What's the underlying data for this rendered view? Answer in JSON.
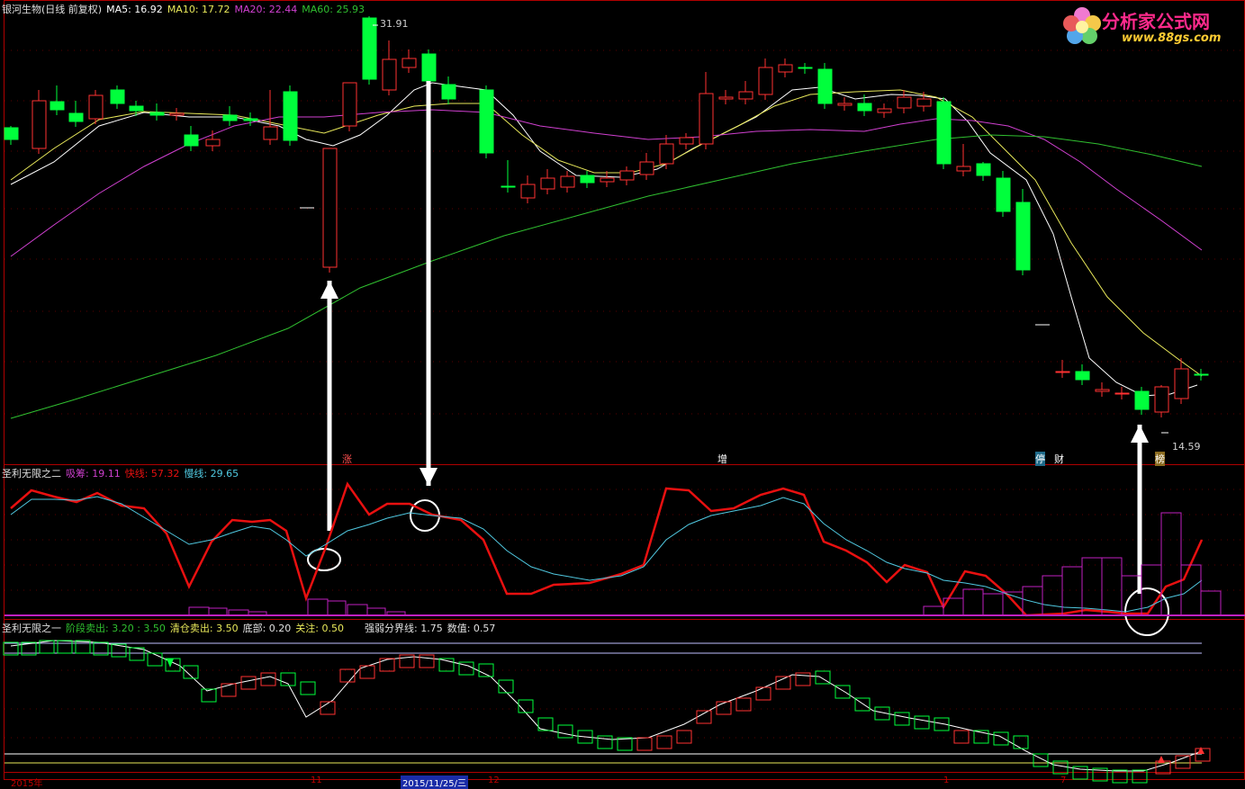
{
  "header": {
    "stock": "银河生物(日线 前复权)",
    "ma5": "MA5: 16.92",
    "ma10": "MA10: 17.72",
    "ma20": "MA20: 22.44",
    "ma60": "MA60: 25.93"
  },
  "logo": {
    "name": "分析家公式网",
    "url": "www.88gs.com"
  },
  "price_high_label": "31.91",
  "price_low_label": "14.59",
  "markers": {
    "zhang": "涨",
    "zeng": "增",
    "ting": "停",
    "cai": "财",
    "bang": "榜"
  },
  "panel1": {
    "title": "圣利无限之二",
    "xichou": "吸筹: 19.11",
    "kuaixian": "快线: 57.32",
    "manxian": "慢线: 29.65"
  },
  "panel2": {
    "title": "圣利无限之一",
    "jieduan": "阶段卖出: 3.20 : 3.50",
    "qingcang": "清仓卖出: 3.50",
    "dibu": "底部: 0.20",
    "guanzhu": "关注: 0.50",
    "qiangruo": "强弱分界线: 1.75",
    "shuzhi": "数值: 0.57"
  },
  "axis": {
    "year": "2015年",
    "nov": "11",
    "selected": "2015/11/25/三",
    "dec": "12",
    "jan": "1",
    "jul": "7"
  },
  "colors": {
    "up": "#ff3232",
    "down": "#00ff3c",
    "ma5": "#ffffff",
    "ma10": "#e8e85a",
    "ma20": "#d040d0",
    "ma60": "#30c030",
    "fast": "#e81010",
    "slow": "#50c8e0",
    "bars": "#c020c0"
  },
  "candles": [
    [
      12.4,
      12.8,
      12.0,
      11.9,
      "d"
    ],
    [
      12.2,
      13.2,
      11.7,
      11.5,
      "u"
    ],
    [
      12.8,
      14.1,
      12.3,
      12.0,
      "d"
    ],
    [
      13.0,
      13.9,
      12.3,
      12.1,
      "d"
    ],
    [
      12.4,
      13.2,
      11.8,
      11.6,
      "u"
    ],
    [
      12.6,
      13.6,
      12.3,
      12.1,
      "d"
    ],
    [
      12.7,
      13.6,
      12.2,
      11.6,
      "d"
    ],
    [
      13.2,
      13.8,
      12.9,
      12.8,
      "d"
    ],
    [
      12.3,
      13.8,
      12.0,
      11.8,
      "u"
    ],
    [
      12.3,
      12.7,
      11.9,
      11.4,
      "d"
    ],
    [
      12.5,
      13.8,
      11.9,
      11.5,
      "u"
    ],
    [
      12.8,
      13.2,
      12.5,
      12.4,
      "d"
    ],
    [
      12.5,
      12.8,
      12.1,
      11.5,
      "d"
    ],
    [
      13.5,
      13.9,
      11.7,
      11.5,
      "d"
    ],
    [
      13.4,
      13.7,
      11.7,
      11.2,
      "u"
    ],
    [
      13.8,
      14.3,
      10.8,
      9.0,
      "d"
    ],
    [
      6.5,
      12.9,
      6.5,
      6.0,
      "u"
    ],
    [
      10.0,
      14.0,
      10.0,
      9.6,
      "u"
    ],
    [
      15.0,
      15.5,
      12.4,
      12.1,
      "d"
    ],
    [
      13.0,
      14.3,
      13.0,
      12.6,
      "u"
    ],
    [
      13.6,
      14.2,
      13.0,
      12.5,
      "u"
    ],
    [
      14.4,
      14.8,
      13.3,
      12.3,
      "d"
    ],
    [
      13.6,
      14.3,
      11.5,
      10.6,
      "d"
    ],
    [
      10.3,
      11.0,
      10.2,
      9.8,
      "u"
    ],
    [
      10.1,
      10.6,
      10.3,
      9.7,
      "u"
    ],
    [
      10.7,
      10.8,
      10.5,
      10.4,
      "d"
    ],
    [
      10.6,
      10.8,
      10.5,
      10.2,
      "d"
    ],
    [
      10.7,
      10.9,
      10.5,
      10.3,
      "u"
    ],
    [
      10.5,
      10.9,
      10.6,
      10.4,
      "d"
    ],
    [
      10.6,
      11.1,
      10.5,
      10.3,
      "d"
    ],
    [
      11.0,
      11.4,
      10.7,
      10.5,
      "d"
    ],
    [
      11.3,
      11.9,
      10.7,
      10.5,
      "d"
    ],
    [
      11.5,
      11.9,
      11.0,
      10.6,
      "u"
    ],
    [
      12.4,
      13.3,
      11.4,
      11.0,
      "u"
    ],
    [
      12.6,
      12.5,
      12.4,
      12.0,
      "u"
    ],
    [
      12.3,
      13.6,
      12.4,
      11.8,
      "u"
    ],
    [
      13.4,
      14.0,
      12.6,
      12.4,
      "d"
    ],
    [
      13.4,
      13.8,
      12.9,
      12.7,
      "d"
    ],
    [
      13.6,
      14.1,
      13.2,
      12.9,
      "u"
    ],
    [
      13.8,
      14.3,
      13.2,
      12.9,
      "u"
    ],
    [
      14.1,
      14.4,
      13.9,
      13.5,
      "d"
    ],
    [
      14.3,
      14.8,
      13.7,
      13.4,
      "u"
    ],
    [
      13.8,
      14.1,
      12.9,
      12.6,
      "d"
    ],
    [
      14.0,
      14.3,
      12.6,
      12.4,
      "d"
    ],
    [
      13.2,
      13.6,
      13.0,
      12.6,
      "d"
    ],
    [
      12.9,
      13.1,
      12.7,
      12.5,
      "u"
    ],
    [
      13.3,
      13.7,
      12.9,
      12.6,
      "d"
    ],
    [
      13.1,
      13.3,
      12.6,
      12.5,
      "d"
    ],
    [
      12.5,
      12.7,
      10.2,
      9.9,
      "d"
    ],
    [
      10.1,
      10.4,
      9.9,
      8.6,
      "u"
    ],
    [
      9.9,
      10.6,
      9.6,
      9.4,
      "d"
    ],
    [
      9.2,
      9.6,
      8.0,
      7.8,
      "d"
    ],
    [
      7.9,
      8.9,
      6.2,
      6.0,
      "d"
    ],
    [
      5.0,
      5.6,
      5.0,
      4.7,
      "u"
    ],
    [
      2.4,
      2.6,
      2.4,
      2.3,
      "u"
    ],
    [
      2.3,
      2.7,
      2.0,
      1.7,
      "d"
    ],
    [
      1.8,
      2.0,
      1.7,
      1.5,
      "u"
    ],
    [
      1.6,
      1.8,
      1.6,
      1.5,
      "u"
    ],
    [
      1.2,
      1.3,
      0.8,
      0.6,
      "d"
    ],
    [
      1.0,
      1.6,
      0.1,
      0.0,
      "u"
    ],
    [
      1.5,
      2.5,
      1.6,
      1.3,
      "u"
    ],
    [
      2.0,
      2.0,
      2.0,
      1.5,
      "d"
    ]
  ]
}
